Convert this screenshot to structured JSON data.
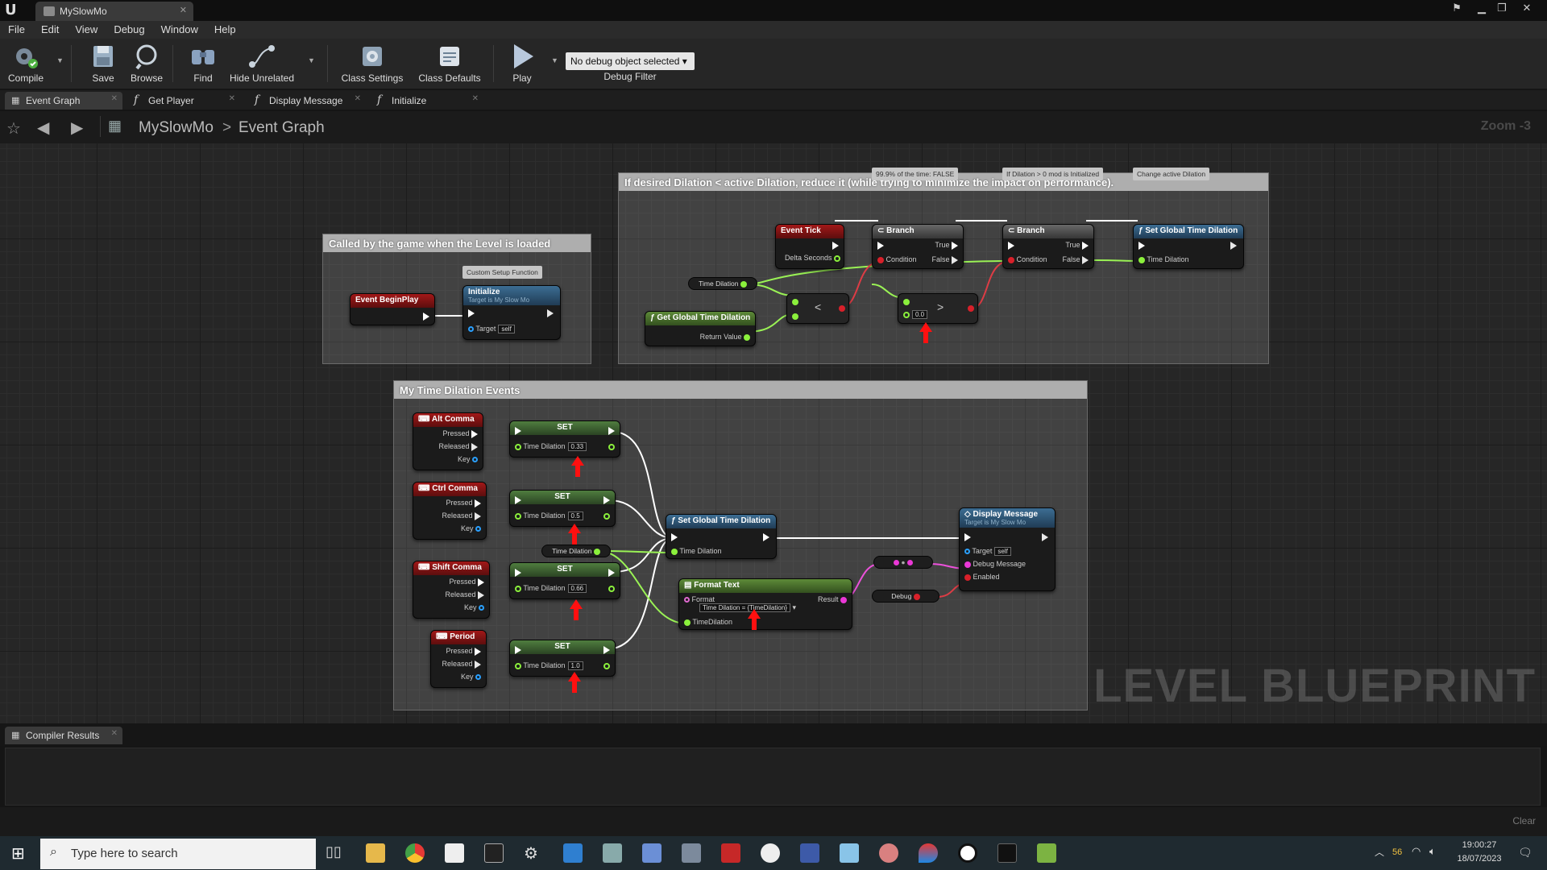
{
  "window": {
    "title": "MySlowMo"
  },
  "menu": [
    "File",
    "Edit",
    "View",
    "Debug",
    "Window",
    "Help"
  ],
  "toolbar": {
    "compile": "Compile",
    "save": "Save",
    "browse": "Browse",
    "find": "Find",
    "hide_unrelated": "Hide Unrelated",
    "class_settings": "Class Settings",
    "class_defaults": "Class Defaults",
    "play": "Play",
    "debug_select": "No debug object selected",
    "debug_filter": "Debug Filter"
  },
  "graph_tabs": [
    "Event Graph",
    "Get Player",
    "Display Message",
    "Initialize"
  ],
  "breadcrumb": {
    "root": "MySlowMo",
    "sep": ">",
    "current": "Event Graph"
  },
  "zoom": "Zoom -3",
  "watermark": "LEVEL BLUEPRINT",
  "comments": {
    "loaded": "Called by the game when the Level is loaded",
    "dilation": "If desired Dilation < active Dilation, reduce it (while trying to minimize the impact on performance).",
    "events": "My Time Dilation Events"
  },
  "bubbles": {
    "custom_setup": "Custom Setup Function",
    "false_most": "99.9% of the time: FALSE",
    "mod_init": "If Dilation > 0 mod is Initialized",
    "change_active": "Change active Dilation"
  },
  "nodes": {
    "event_beginplay": "Event BeginPlay",
    "initialize": "Initialize",
    "target_my_slow_mo": "Target is My Slow Mo",
    "target": "Target",
    "self": "self",
    "event_tick": "Event Tick",
    "delta_seconds": "Delta Seconds",
    "branch": "Branch",
    "condition": "Condition",
    "true": "True",
    "false": "False",
    "set_global_time_dilation": "Set Global Time Dilation",
    "time_dilation": "Time Dilation",
    "get_global_time_dilation": "Get Global Time Dilation",
    "return_value": "Return Value",
    "less": "<",
    "greater": ">",
    "zero": "0.0",
    "set": "SET",
    "pressed": "Pressed",
    "released": "Released",
    "key": "Key",
    "alt_comma": "Alt Comma",
    "ctrl_comma": "Ctrl Comma",
    "shift_comma": "Shift Comma",
    "period": "Period",
    "val_alt": "0.33",
    "val_ctrl": "0.5",
    "val_shift": "0.66",
    "val_period": "1.0",
    "time_dilation_var": "Time Dilation",
    "time_dilation_nospace": "TimeDilation",
    "format_text": "Format Text",
    "format": "Format",
    "format_value": "Time Dilation = {TimeDilation}",
    "result": "Result",
    "display_message": "Display Message",
    "debug_message": "Debug Message",
    "enabled": "Enabled",
    "debug": "Debug",
    "conv": "●"
  },
  "compiler": {
    "tab": "Compiler Results",
    "clear": "Clear"
  },
  "taskbar": {
    "search_placeholder": "Type here to search",
    "time": "19:00:27",
    "date": "18/07/2023",
    "temp": "56"
  }
}
